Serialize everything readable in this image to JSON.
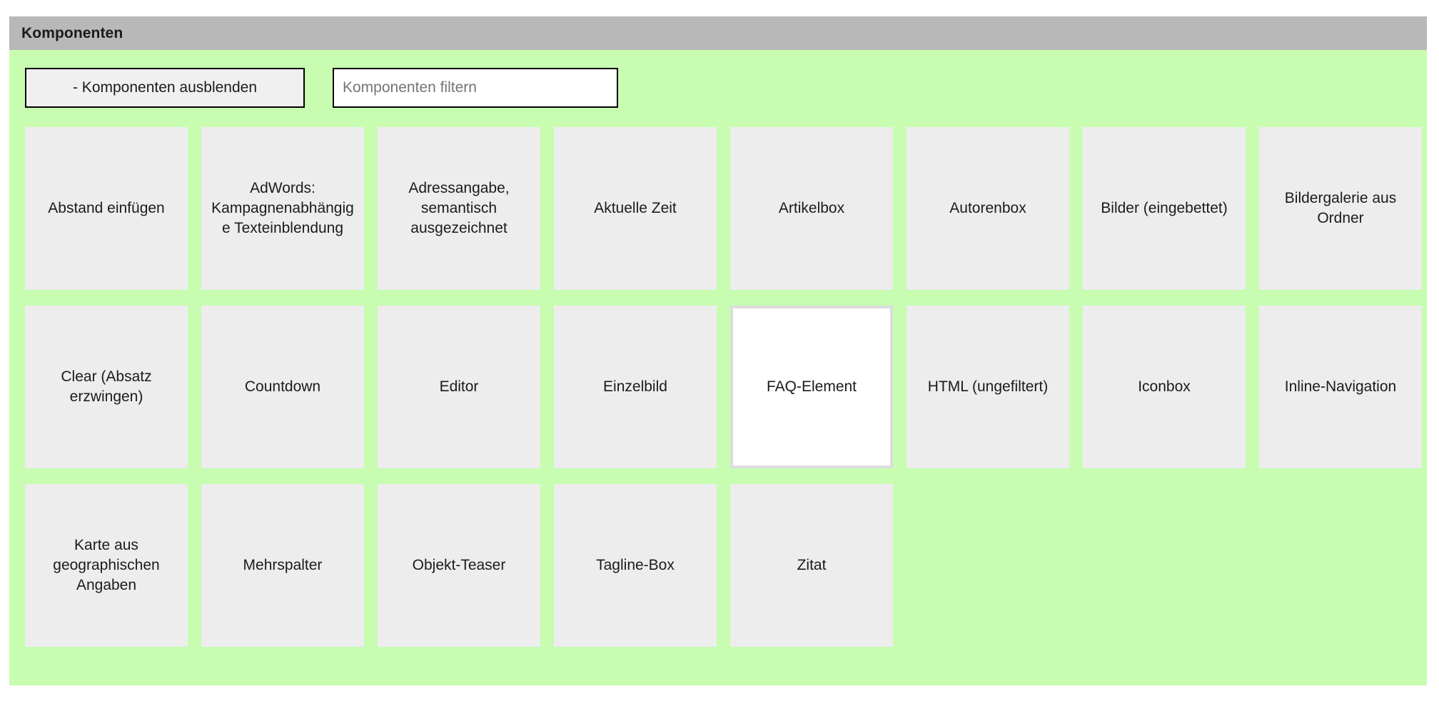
{
  "header": {
    "title": "Komponenten"
  },
  "toolbar": {
    "toggle_label": "- Komponenten ausblenden",
    "filter_placeholder": "Komponenten filtern",
    "filter_value": ""
  },
  "components": [
    {
      "label": "Abstand einfügen",
      "active": false
    },
    {
      "label": "AdWords: Kampagnenabhängige Texteinblendung",
      "active": false
    },
    {
      "label": "Adressangabe, semantisch ausgezeichnet",
      "active": false
    },
    {
      "label": "Aktuelle Zeit",
      "active": false
    },
    {
      "label": "Artikelbox",
      "active": false
    },
    {
      "label": "Autorenbox",
      "active": false
    },
    {
      "label": "Bilder (eingebettet)",
      "active": false
    },
    {
      "label": "Bildergalerie aus Ordner",
      "active": false
    },
    {
      "label": "Clear (Absatz erzwingen)",
      "active": false
    },
    {
      "label": "Countdown",
      "active": false
    },
    {
      "label": "Editor",
      "active": false
    },
    {
      "label": "Einzelbild",
      "active": false
    },
    {
      "label": "FAQ-Element",
      "active": true
    },
    {
      "label": "HTML (ungefiltert)",
      "active": false
    },
    {
      "label": "Iconbox",
      "active": false
    },
    {
      "label": "Inline-Navigation",
      "active": false
    },
    {
      "label": "Karte aus geographischen Angaben",
      "active": false
    },
    {
      "label": "Mehrspalter",
      "active": false
    },
    {
      "label": "Objekt-Teaser",
      "active": false
    },
    {
      "label": "Tagline-Box",
      "active": false
    },
    {
      "label": "Zitat",
      "active": false
    }
  ],
  "colors": {
    "header_bg": "#b8b8b8",
    "panel_bg": "#c7fcb1",
    "tile_bg": "#ededed",
    "tile_active_bg": "#ffffff",
    "tile_active_border": "#dddddd",
    "text": "#1b1b1b",
    "placeholder": "#757575"
  }
}
